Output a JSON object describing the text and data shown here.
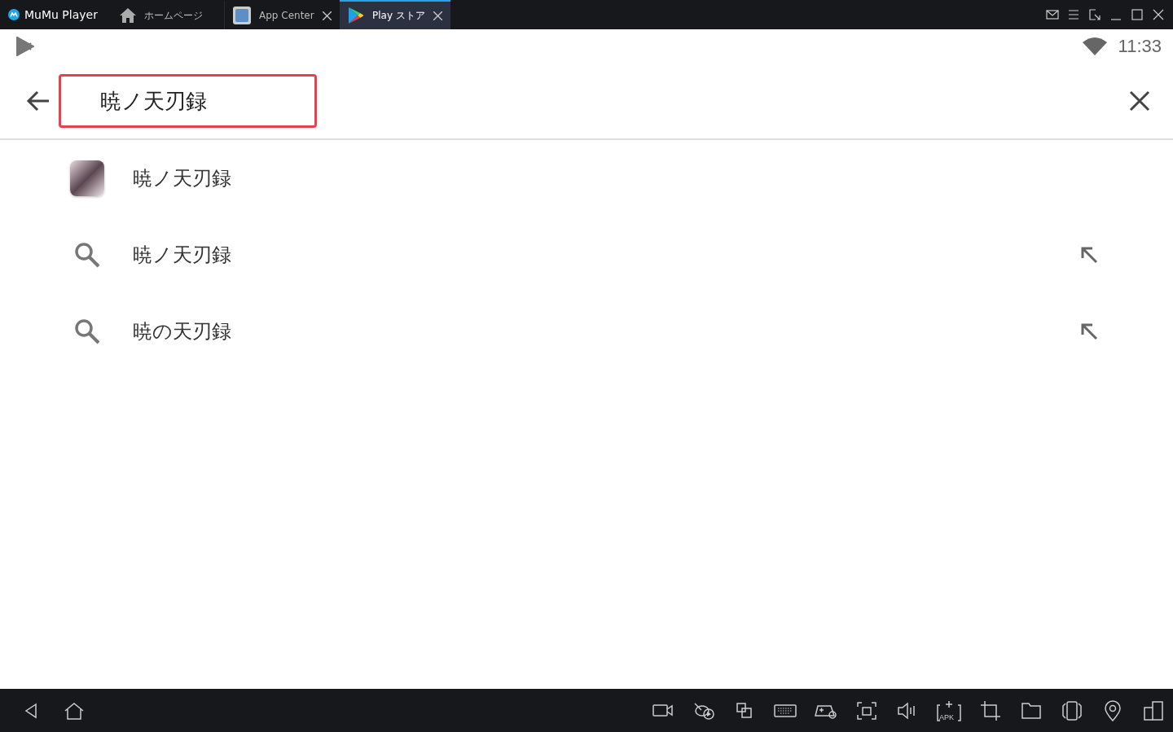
{
  "title_bar": {
    "app_name": "MuMu Player",
    "tabs": [
      {
        "kind": "home",
        "label": "ホームページ",
        "selected": false,
        "closable": false
      },
      {
        "kind": "app",
        "label": "App Center",
        "selected": false,
        "closable": true
      },
      {
        "kind": "play",
        "label": "Play ストア",
        "selected": true,
        "closable": true
      }
    ]
  },
  "status_bar": {
    "time": "11:33"
  },
  "search": {
    "value": "暁ノ天刃録"
  },
  "suggestions": [
    {
      "kind": "app",
      "text": "暁ノ天刃録"
    },
    {
      "kind": "query",
      "text": "暁ノ天刃録"
    },
    {
      "kind": "query",
      "text": "暁の天刃録"
    }
  ],
  "bottom_bar": {
    "apk_label": "APK"
  }
}
